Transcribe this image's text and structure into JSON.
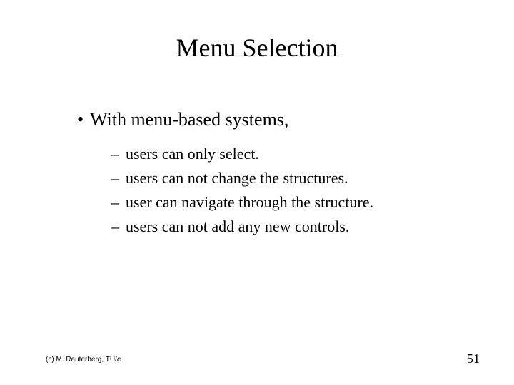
{
  "title": "Menu Selection",
  "bullet": {
    "marker": "•",
    "text": "With menu-based systems,"
  },
  "sub": {
    "marker": "–",
    "items": [
      "users can only select.",
      "users can not change the structures.",
      "user can navigate through the structure.",
      "users can not add any new controls."
    ]
  },
  "footer": {
    "left": "(c) M. Rauterberg, TU/e",
    "right": "51"
  }
}
